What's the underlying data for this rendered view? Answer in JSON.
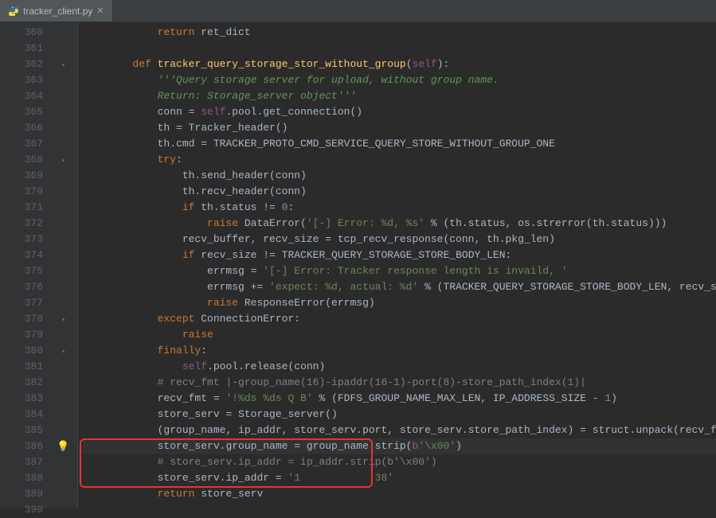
{
  "tab": {
    "filename": "tracker_client.py"
  },
  "line_numbers": [
    360,
    361,
    362,
    363,
    364,
    365,
    366,
    367,
    368,
    369,
    370,
    371,
    372,
    373,
    374,
    375,
    376,
    377,
    378,
    379,
    380,
    381,
    382,
    383,
    384,
    385,
    386,
    387,
    388,
    389,
    390
  ],
  "code": {
    "l360": {
      "indent": "            ",
      "kw": "return ",
      "rest": "ret_dict"
    },
    "l362": {
      "indent": "        ",
      "kw": "def ",
      "fn": "tracker_query_storage_stor_without_group",
      "p1": "(",
      "self": "self",
      "p2": "):"
    },
    "l363": {
      "indent": "            ",
      "doc": "'''Query storage server for upload, without group name."
    },
    "l364": {
      "indent": "            ",
      "doc": "Return: Storage_server object'''"
    },
    "l365": {
      "indent": "            ",
      "v": "conn = ",
      "self": "self",
      "rest": ".pool.get_connection()"
    },
    "l366": {
      "indent": "            ",
      "rest": "th = Tracker_header()"
    },
    "l367": {
      "indent": "            ",
      "rest": "th.cmd = TRACKER_PROTO_CMD_SERVICE_QUERY_STORE_WITHOUT_GROUP_ONE"
    },
    "l368": {
      "indent": "            ",
      "kw": "try",
      "c": ":"
    },
    "l369": {
      "indent": "                ",
      "rest": "th.send_header(conn)"
    },
    "l370": {
      "indent": "                ",
      "rest": "th.recv_header(conn)"
    },
    "l371": {
      "indent": "                ",
      "kw": "if ",
      "rest": "th.status != ",
      "num": "0",
      "c": ":"
    },
    "l372": {
      "indent": "                    ",
      "kw": "raise ",
      "rest": "DataError(",
      "str": "'[-] Error: %d, %s'",
      "rest2": " % (th.status, os.strerror(th.status)))"
    },
    "l373": {
      "indent": "                ",
      "rest": "recv_buffer, recv_size = tcp_recv_response(conn, th.pkg_len)"
    },
    "l374": {
      "indent": "                ",
      "kw": "if ",
      "rest": "recv_size != TRACKER_QUERY_STORAGE_STORE_BODY_LEN:"
    },
    "l375": {
      "indent": "                    ",
      "rest": "errmsg = ",
      "str": "'[-] Error: Tracker response length is invaild, '"
    },
    "l376": {
      "indent": "                    ",
      "rest": "errmsg += ",
      "str": "'expect: %d, actual: %d'",
      "rest2": " % (TRACKER_QUERY_STORAGE_STORE_BODY_LEN, recv_size)"
    },
    "l377": {
      "indent": "                    ",
      "kw": "raise ",
      "rest": "ResponseError(errmsg)"
    },
    "l378": {
      "indent": "            ",
      "kw": "except ",
      "rest": "ConnectionError:"
    },
    "l379": {
      "indent": "                ",
      "kw": "raise"
    },
    "l380": {
      "indent": "            ",
      "kw": "finally",
      "c": ":"
    },
    "l381": {
      "indent": "                ",
      "self": "self",
      "rest": ".pool.release(conn)"
    },
    "l382": {
      "indent": "            ",
      "comment": "# recv_fmt |-group_name(16)-ipaddr(16-1)-port(8)-store_path_index(1)|"
    },
    "l383": {
      "indent": "            ",
      "rest": "recv_fmt = ",
      "str": "'!%ds %ds Q B'",
      "rest2": " % (FDFS_GROUP_NAME_MAX_LEN, IP_ADDRESS_SIZE - ",
      "num": "1",
      "p": ")"
    },
    "l384": {
      "indent": "            ",
      "rest": "store_serv = Storage_server()"
    },
    "l385": {
      "indent": "            ",
      "rest": "(group_name, ip_addr, store_serv.port, store_serv.store_path_index) = struct.unpack(recv_fmt, recv_buffer)"
    },
    "l386": {
      "indent": "            ",
      "rest": "store_serv.group_name = group_name.strip(",
      "bpre": "b",
      "str": "'\\x00'",
      "p": ")"
    },
    "l387": {
      "indent": "            ",
      "comment": "# store_serv.ip_addr = ip_addr.strip(b'\\x00')"
    },
    "l388": {
      "indent": "            ",
      "rest": "store_serv.ip_addr = ",
      "str": "'1            38'"
    },
    "l389": {
      "indent": "            ",
      "kw": "return ",
      "rest": "store_serv"
    }
  }
}
